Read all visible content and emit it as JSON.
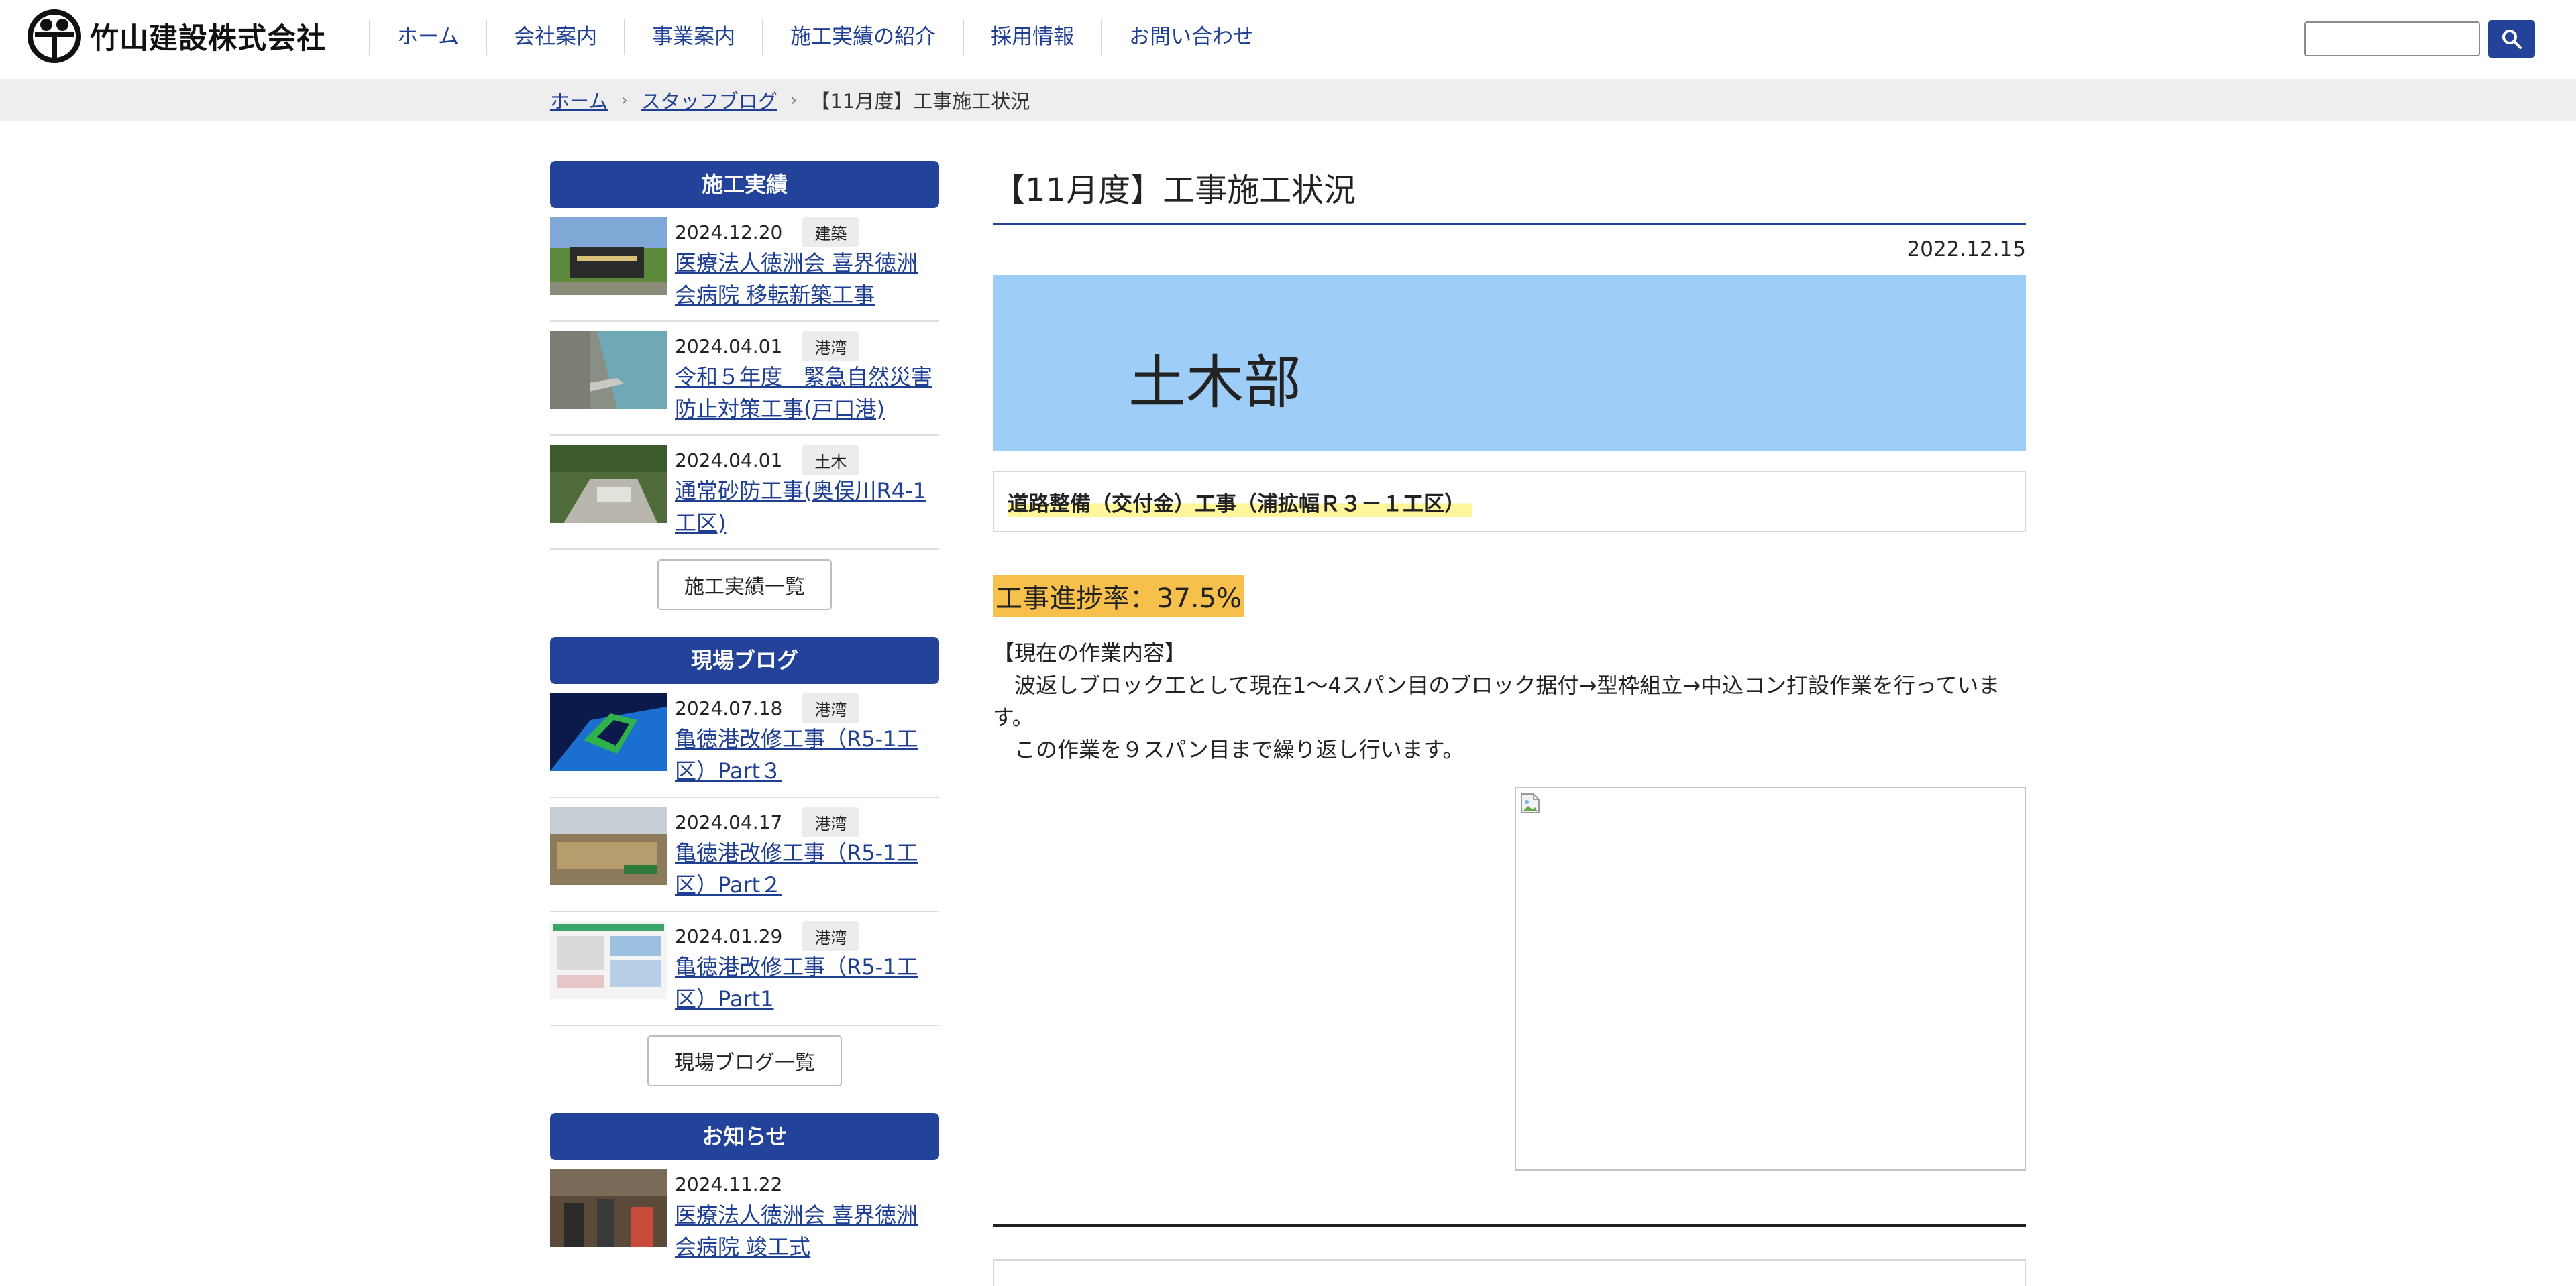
{
  "header": {
    "company_name": "竹山建設株式会社",
    "nav": [
      "ホーム",
      "会社案内",
      "事業案内",
      "施工実績の紹介",
      "採用情報",
      "お問い合わせ"
    ],
    "search_placeholder": ""
  },
  "breadcrumb": {
    "home": "ホーム",
    "blog": "スタッフブログ",
    "current": "【11月度】工事施工状況"
  },
  "sidebar": {
    "sections": [
      {
        "heading": "施工実績",
        "items": [
          {
            "date": "2024.12.20",
            "tag": "建築",
            "title": "医療法人徳洲会 喜界徳洲会病院 移転新築工事"
          },
          {
            "date": "2024.04.01",
            "tag": "港湾",
            "title": "令和５年度　緊急自然災害防止対策工事(戸口港)"
          },
          {
            "date": "2024.04.01",
            "tag": "土木",
            "title": "通常砂防工事(奥俣川R4-1工区)"
          }
        ],
        "more": "施工実績一覧"
      },
      {
        "heading": "現場ブログ",
        "items": [
          {
            "date": "2024.07.18",
            "tag": "港湾",
            "title": "亀徳港改修工事（R5-1工区）Part３"
          },
          {
            "date": "2024.04.17",
            "tag": "港湾",
            "title": "亀徳港改修工事（R5-1工区）Part２"
          },
          {
            "date": "2024.01.29",
            "tag": "港湾",
            "title": "亀徳港改修工事（R5-1工区）Part1"
          }
        ],
        "more": "現場ブログ一覧"
      },
      {
        "heading": "お知らせ",
        "items": [
          {
            "date": "2024.11.22",
            "tag": "",
            "title": "医療法人徳洲会 喜界徳洲会病院 竣工式"
          }
        ],
        "more": ""
      }
    ]
  },
  "article": {
    "title": "【11月度】工事施工状況",
    "date": "2022.12.15",
    "department": "土木部",
    "project": "道路整備（交付金）工事（浦拡幅Ｒ３－１工区）",
    "progress": "工事進捗率：37.5%",
    "body_heading": "【現在の作業内容】",
    "body_line1": "　波返しブロック工として現在1〜4スパン目のブロック据付→型枠組立→中込コン打設作業を行っています。",
    "body_line2": "　この作業を９スパン目まで繰り返し行います。"
  },
  "colors": {
    "brand_blue": "#23439a",
    "dept_banner": "#9ecdf7",
    "progress_highlight": "#f7c04c",
    "project_highlight": "#fff59a"
  }
}
